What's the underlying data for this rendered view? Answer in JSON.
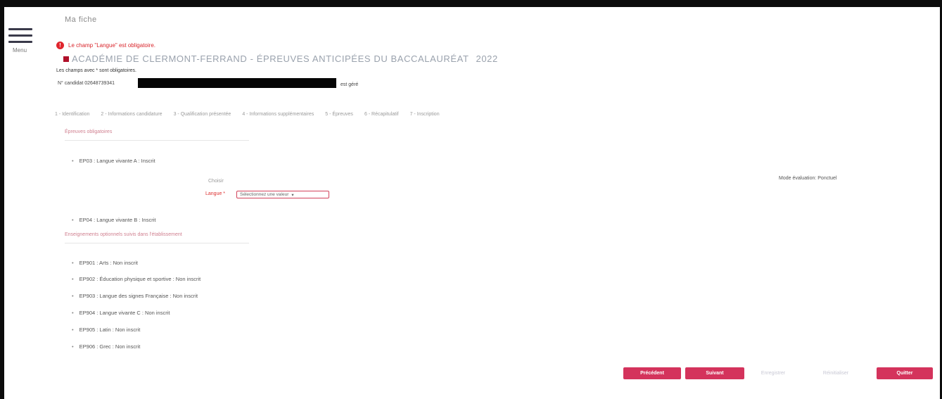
{
  "page": {
    "top_title": "Ma fiche",
    "menu_label": "Menu",
    "error_message": "Le champ \"Langue\" est obligatoire.",
    "academy_title": "ACADÉMIE DE CLERMONT-FERRAND - ÉPREUVES ANTICIPÉES DU BACCALAURÉAT",
    "academy_year": "2022",
    "mandatory_note": "Les champs avec * sont obligatoires.",
    "candidate_prefix": "N° candidat 02648739341",
    "candidate_suffix": "est géré",
    "right_note": "Mode évaluation: Ponctuel"
  },
  "steps": [
    "1 - Identification",
    "2 - Informations candidature",
    "3 - Qualification présentée",
    "4 - Informations supplémentaires",
    "5 - Épreuves",
    "6 - Récapitulatif",
    "7 - Inscription"
  ],
  "sections": [
    {
      "label": "Épreuves obligatoires"
    },
    {
      "label": "Enseignements optionnels suivis dans l'établissement"
    }
  ],
  "obligatoires": [
    "EP03 : Langue vivante A : Inscrit",
    "EP04 : Langue vivante B : Inscrit"
  ],
  "form": {
    "choice_label": "Choisir",
    "langue_label": "Langue *",
    "select_value": "Sélectionnez une valeur"
  },
  "optionnels": [
    "EP901 : Arts : Non inscrit",
    "EP902 : Éducation physique et sportive : Non inscrit",
    "EP903 : Langue des signes Française : Non inscrit",
    "EP904 : Langue vivante C : Non inscrit",
    "EP905 : Latin : Non inscrit",
    "EP906 : Grec : Non inscrit"
  ],
  "buttons": {
    "previous": "Précédent",
    "next": "Suivant",
    "save": "Enregistrer",
    "reset": "Réinitialiser",
    "quit": "Quitter"
  },
  "colors": {
    "accent": "#d4335c",
    "error": "#e0252d"
  }
}
